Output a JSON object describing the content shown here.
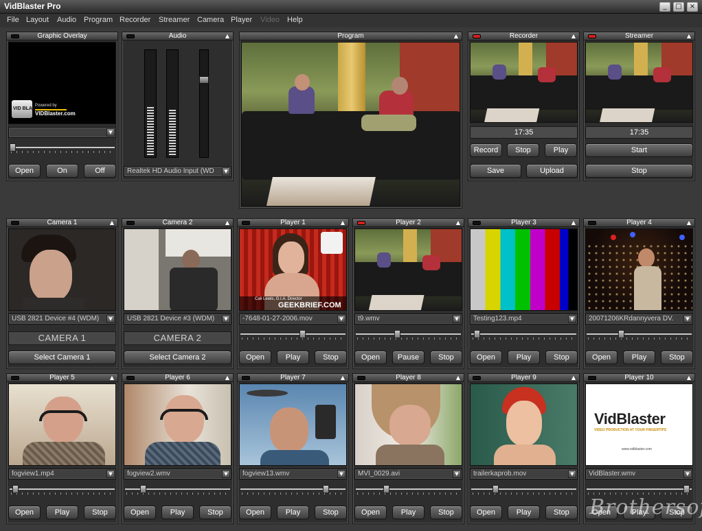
{
  "window": {
    "title": "VidBlaster Pro"
  },
  "menu": [
    "File",
    "Layout",
    "Audio",
    "Program",
    "Recorder",
    "Streamer",
    "Camera",
    "Player",
    "Video",
    "Help"
  ],
  "graphic_overlay": {
    "title": "Graphic Overlay",
    "logo_text": "VID BLASTER",
    "powered_by": "Powered by",
    "logo_brand": "VIDBlaster.com",
    "select_value": "",
    "open_label": "Open",
    "on_label": "On",
    "off_label": "Off"
  },
  "audio": {
    "title": "Audio",
    "input_device": "Realtek HD Audio Input (WD",
    "level_left": 0.47,
    "level_right": 0.43
  },
  "program": {
    "title": "Program"
  },
  "recorder": {
    "title": "Recorder",
    "time": "17:35",
    "record_label": "Record",
    "stop_label": "Stop",
    "play_label": "Play",
    "save_label": "Save",
    "upload_label": "Upload"
  },
  "streamer": {
    "title": "Streamer",
    "time": "17:35",
    "start_label": "Start",
    "stop_label": "Stop"
  },
  "cameras": [
    {
      "title": "Camera 1",
      "device": "USB 2821 Device #4 (WDM)",
      "label": "CAMERA 1",
      "select_label": "Select Camera 1"
    },
    {
      "title": "Camera 2",
      "device": "USB 2821 Device #3 (WDM)",
      "label": "CAMERA 2",
      "select_label": "Select Camera 2"
    }
  ],
  "players_top": [
    {
      "title": "Player 1",
      "file": "-7648-01-27-2006.mov",
      "position": 0.57,
      "buttons": [
        "Open",
        "Play",
        "Stop"
      ],
      "caption_name": "Cali Lewis, G.I.A. Director",
      "caption_brand": "GEEKBRIEF.COM",
      "active": false
    },
    {
      "title": "Player 2",
      "file": "t9.wmv",
      "position": 0.39,
      "buttons": [
        "Open",
        "Pause",
        "Stop"
      ],
      "active": true
    },
    {
      "title": "Player 3",
      "file": "Testing123.mp4",
      "position": 0.03,
      "buttons": [
        "Open",
        "Play",
        "Stop"
      ],
      "active": false
    },
    {
      "title": "Player 4",
      "file": "20071206KRdannyvera DV.",
      "position": 0.31,
      "buttons": [
        "Open",
        "Play",
        "Stop"
      ],
      "active": false
    }
  ],
  "players_bottom": [
    {
      "title": "Player 5",
      "file": "fogview1.mp4",
      "position": 0.03,
      "buttons": [
        "Open",
        "Play",
        "Stop"
      ]
    },
    {
      "title": "Player 6",
      "file": "fogview2.wmv",
      "position": 0.15,
      "buttons": [
        "Open",
        "Play",
        "Stop"
      ]
    },
    {
      "title": "Player 7",
      "file": "fogview13.wmv",
      "position": 0.79,
      "buttons": [
        "Open",
        "Play",
        "Stop"
      ]
    },
    {
      "title": "Player 8",
      "file": "MVI_0029.avi",
      "position": 0.27,
      "buttons": [
        "Open",
        "Play",
        "Stop"
      ]
    },
    {
      "title": "Player 9",
      "file": "trailerkaprob.mov",
      "position": 0.21,
      "buttons": [
        "Open",
        "Play",
        "Stop"
      ]
    },
    {
      "title": "Player 10",
      "file": "VidBlaster.wmv",
      "position": 0.93,
      "buttons": [
        "Open",
        "Play",
        "Stop"
      ],
      "brand": "VidBlaster",
      "tagline": "VIDEO PRODUCTION AT YOUR FINGERTIPS",
      "url": "www.vidblaster.com"
    }
  ],
  "watermark": "Brothersoft"
}
